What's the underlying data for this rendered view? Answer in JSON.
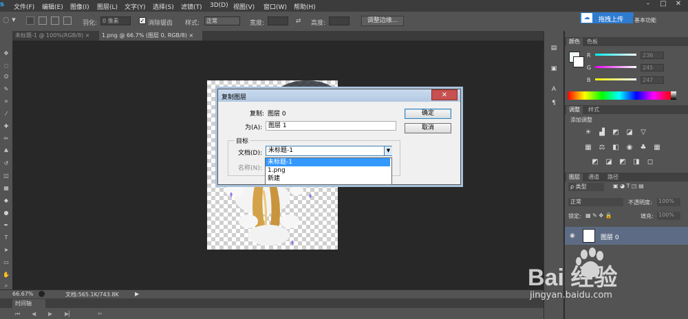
{
  "app": {
    "logo": "s"
  },
  "menubar": {
    "items": [
      "文件(F)",
      "编辑(E)",
      "图像(I)",
      "图层(L)",
      "文字(Y)",
      "选择(S)",
      "滤镜(T)",
      "3D(D)",
      "视图(V)",
      "窗口(W)",
      "帮助(H)"
    ],
    "upload_label": "拖拽上传",
    "workspace": "基本功能"
  },
  "options": {
    "feather_label": "羽化:",
    "feather_value": "0 像素",
    "antialias_label": "消除锯齿",
    "style_label": "样式:",
    "style_value": "正常",
    "width_label": "宽度:",
    "height_label": "高度:",
    "refine_edge": "调整边缘..."
  },
  "tabs": [
    {
      "label": "未标题-1 @ 100%(RGB/8)"
    },
    {
      "label": "1.png @ 66.7% (图层 0, RGB/8)"
    }
  ],
  "dialog": {
    "title": "复制图层",
    "source_label": "复制:",
    "source_value": "图层 0",
    "as_label": "为(A):",
    "as_value": "图层 1",
    "ok": "确定",
    "cancel": "取消",
    "group_label": "目标",
    "doc_label": "文档(D):",
    "doc_value": "未标题-1",
    "name_label": "名称(N):",
    "doc_options": [
      "未标题-1",
      "1.png",
      "新建"
    ]
  },
  "status": {
    "zoom": "66.67%",
    "doc_info": "文档:565.1K/743.8K",
    "timeline": "时间轴"
  },
  "panels": {
    "color_tabs": [
      "颜色",
      "色板"
    ],
    "r_label": "R",
    "g_label": "G",
    "b_label": "B",
    "r_value": "236",
    "g_value": "245",
    "b_value": "247",
    "adjust_tabs": [
      "调整",
      "样式"
    ],
    "add_adjustment": "添加调整",
    "layers_tabs": [
      "图层",
      "通道",
      "路径"
    ],
    "kind_filter": "ρ 类型",
    "blend_mode": "正常",
    "opacity_label": "不透明度:",
    "opacity_value": "100%",
    "lock_label": "锁定:",
    "fill_label": "填充:",
    "fill_value": "100%",
    "layer_name": "图层 0"
  },
  "watermark": {
    "text": "Bai 经验",
    "url": "jingyan.baidu.com"
  },
  "colors": {
    "accent": "#3399ff",
    "panel": "#535353",
    "layer_selected": "#5d6c84"
  }
}
